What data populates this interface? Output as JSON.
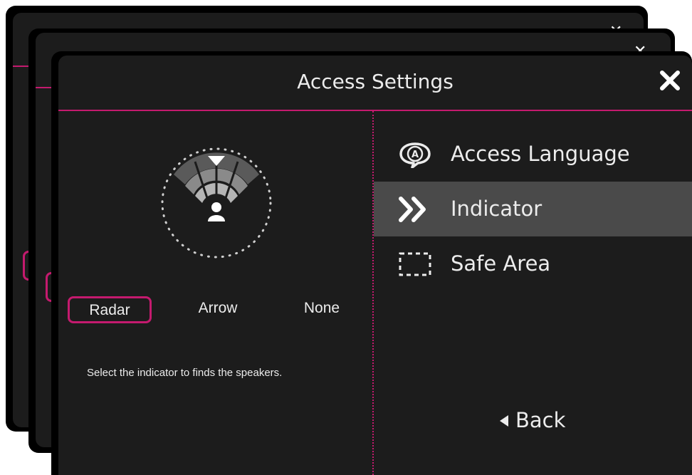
{
  "dialog": {
    "title": "Access Settings",
    "close_icon": "close-icon"
  },
  "indicator_panel": {
    "preview_icon": "radar-indicator-icon",
    "options": [
      {
        "label": "Radar",
        "selected": true
      },
      {
        "label": "Arrow",
        "selected": false
      },
      {
        "label": "None",
        "selected": false
      }
    ],
    "hint": "Select the indicator to finds the speakers."
  },
  "menu": {
    "items": [
      {
        "label": "Access Language",
        "icon": "language-bubble-icon",
        "active": false
      },
      {
        "label": "Indicator",
        "icon": "double-chevron-icon",
        "active": true
      },
      {
        "label": "Safe Area",
        "icon": "dashed-frame-icon",
        "active": false
      }
    ],
    "back_label": "Back"
  },
  "colors": {
    "accent": "#c41a6e",
    "panel_bg": "#1c1c1c",
    "active_bg": "#4a4a4a",
    "text": "#ececec"
  }
}
